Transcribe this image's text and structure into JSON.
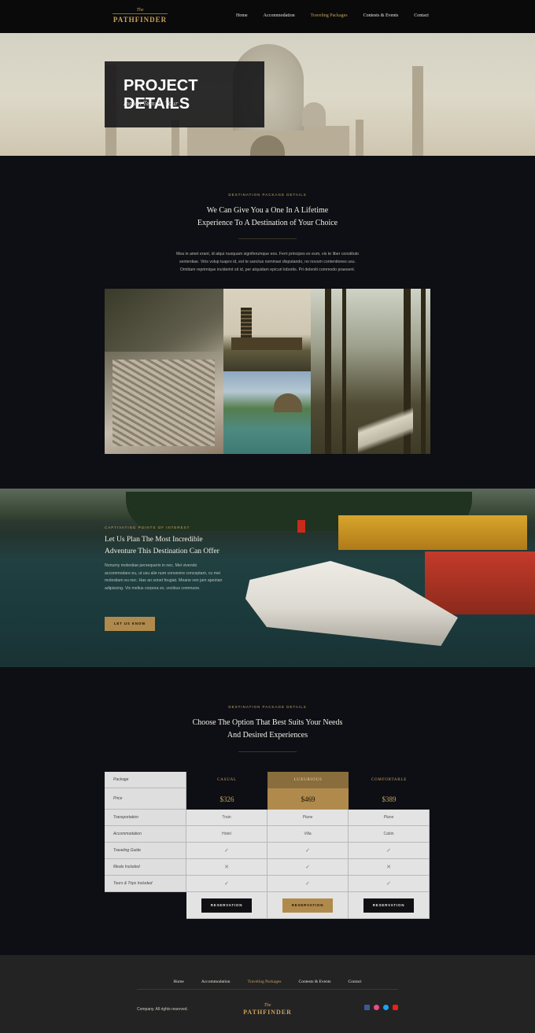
{
  "brand": {
    "the": "The",
    "name": "PATHFINDER"
  },
  "nav": {
    "items": [
      "Home",
      "Accommodation",
      "Traveling Packages",
      "Contests & Events",
      "Contact"
    ],
    "active": "Traveling Packages"
  },
  "hero": {
    "title": "PROJECT DETAILS",
    "subtitle": "Indian Temple Tour"
  },
  "intro": {
    "kicker": "DESTINATION PACKAGE DETAILS",
    "title_line1": "We Can Give You a One In A Lifetime",
    "title_line2": "Experience To A Destination of Your Choice",
    "para_line1": "Mea in amet erant, id atqui nusquam signiferumque eos. Ferri principes ex eum, vis te liber constituto",
    "para_line2": "sententiae. Viris volup tuapro id, est te sanctus nominavi disputando, no novum contentiones usu.",
    "para_line3": "Omittam reprimique inciderint sit id, per atquidam epicuri lobortis. Pri deleniti commodo praesent."
  },
  "band": {
    "kicker": "CAPTIVATING POINTS OF INTEREST",
    "title_line1": "Let Us Plan The Most Incredible",
    "title_line2": "Adventure This Destination Can Offer",
    "para": "Nonumy molestiae persequeris in nec. Mei vivendo accommodare eu, ut usu alie num convenire conceptam, cu mei molestiam eu nec. Has an sonet feugiat. Meane ven jam apeirian adipiscing. Vix melius corpora ex, vocibus commune.",
    "button": "LET US KNOW"
  },
  "pricing": {
    "kicker": "DESTINATION PACKAGE DETAILS",
    "title_line1": "Choose The Option That Best Suits Your Needs",
    "title_line2": "And Desired Experiences",
    "labels": {
      "package": "Package",
      "price": "Price"
    },
    "plans": [
      {
        "name": "CASUAL",
        "price": "$326",
        "transportation": "Train",
        "accommodation": "Hotel",
        "guide": "✓",
        "meals": "✕",
        "tours": "✓",
        "button": "RESERVATION"
      },
      {
        "name": "LUXURIOUS",
        "price": "$469",
        "transportation": "Plane",
        "accommodation": "Villa",
        "guide": "✓",
        "meals": "✓",
        "tours": "✓",
        "button": "RESERVATION"
      },
      {
        "name": "COMFORTABLE",
        "price": "$389",
        "transportation": "Plane",
        "accommodation": "Cabin",
        "guide": "✓",
        "meals": "✕",
        "tours": "✓",
        "button": "RESERVATION"
      }
    ],
    "features": [
      "Transportation",
      "Accommodation",
      "Traveling Guide",
      "Meals Included",
      "Tours & Trips Included"
    ]
  },
  "footer": {
    "links": [
      "Home",
      "Accommodation",
      "Traveling Packages",
      "Contests & Events",
      "Contact"
    ],
    "copyright": "Company. All rights reserved.",
    "social": [
      {
        "icon": "facebook-icon",
        "color": "#3b5998"
      },
      {
        "icon": "dribbble-icon",
        "color": "#ea4c89"
      },
      {
        "icon": "twitter-icon",
        "color": "#1da1f2"
      },
      {
        "icon": "youtube-icon",
        "color": "#e62117"
      }
    ]
  },
  "colors": {
    "accent": "#c9a25e",
    "background": "#0e0f14"
  }
}
